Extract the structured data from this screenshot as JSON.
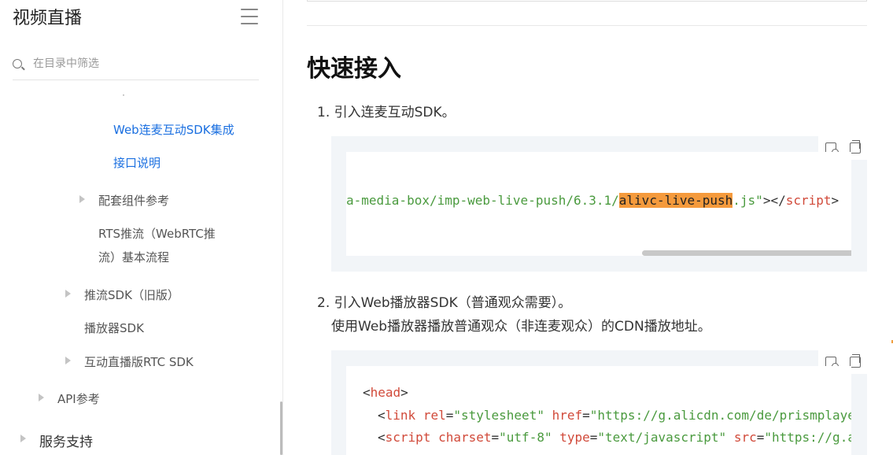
{
  "sidebar": {
    "title": "视频直播",
    "search_placeholder": "在目录中筛选",
    "cut_text": "·",
    "items": [
      {
        "label": "Web连麦互动SDK集成"
      },
      {
        "label": "接口说明"
      },
      {
        "label": "配套组件参考"
      },
      {
        "label": "RTS推流（WebRTC推"
      },
      {
        "label": "流）基本流程"
      },
      {
        "label": "推流SDK（旧版）"
      },
      {
        "label": "播放器SDK"
      },
      {
        "label": "互动直播版RTC SDK"
      },
      {
        "label": "API参考"
      },
      {
        "label": "服务支持"
      }
    ]
  },
  "main": {
    "heading": "快速接入",
    "step1": "1. 引入连麦互动SDK。",
    "code1": {
      "str_a": "a-media-box/imp-web-live-push/6.3.1/",
      "highlight": "alivc-live-push",
      "str_b": ".js\"",
      "plain": "></",
      "tag": "script",
      "end": ">"
    },
    "step2": "2. 引入Web播放器SDK（普通观众需要）。",
    "step2_sub": "使用Web播放器播放普通观众（非连麦观众）的CDN播放地址。",
    "code2": {
      "line1_tag": "head",
      "line2_tag": "link",
      "line2_attr1": "rel",
      "line2_val1": "\"stylesheet\"",
      "line2_attr2": "href",
      "line2_val2": "\"https://g.alicdn.com/de/prismplaye",
      "line3_tag": "script",
      "line3_attr1": "charset",
      "line3_val1": "\"utf-8\"",
      "line3_attr2": "type",
      "line3_val2": "\"text/javascript\"",
      "line3_attr3": "src",
      "line3_val3": "\"https://g.a"
    }
  },
  "colors": {
    "link_active": "#1a6fe0",
    "string_green": "#4a9a3e",
    "tag_red": "#d14a3a",
    "highlight_orange": "#f59a3c"
  }
}
